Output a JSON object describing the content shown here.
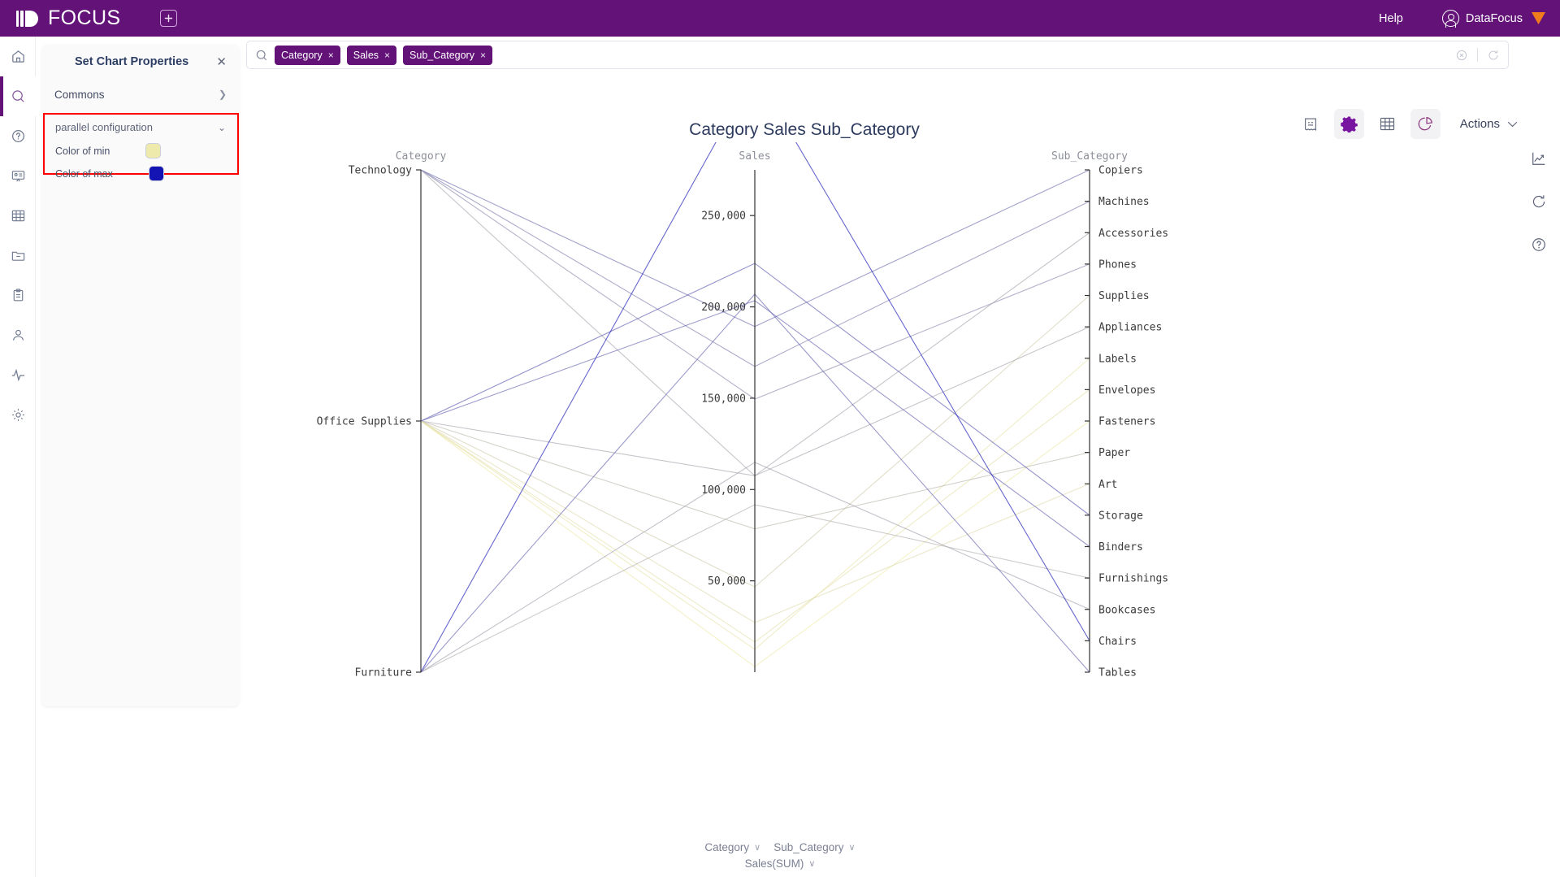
{
  "topbar": {
    "logo_text": "FOCUS",
    "add_tab_label": "+",
    "help_label": "Help",
    "user_name": "DataFocus"
  },
  "sidebar": {
    "items": [
      {
        "name": "home",
        "label": "Home",
        "active": false
      },
      {
        "name": "search",
        "label": "Search",
        "active": true
      },
      {
        "name": "help",
        "label": "Help",
        "active": false
      },
      {
        "name": "presentation",
        "label": "Presentation",
        "active": false
      },
      {
        "name": "table",
        "label": "Table",
        "active": false
      },
      {
        "name": "folder",
        "label": "Folder",
        "active": false
      },
      {
        "name": "clipboard",
        "label": "Clipboard",
        "active": false
      },
      {
        "name": "user",
        "label": "User",
        "active": false
      },
      {
        "name": "activity",
        "label": "Activity",
        "active": false
      },
      {
        "name": "settings",
        "label": "Settings",
        "active": false
      }
    ]
  },
  "panel": {
    "title": "Set Chart Properties",
    "commons_label": "Commons",
    "config_title": "parallel configuration",
    "color_min_label": "Color of min",
    "color_max_label": "Color of max",
    "color_min_value": "#eeeaab",
    "color_max_value": "#1414b4",
    "highlight_color": "#ff0000"
  },
  "search": {
    "chips": [
      "Category",
      "Sales",
      "Sub_Category"
    ],
    "chip_close_glyph": "×"
  },
  "chart_toolbar": {
    "buttons": [
      {
        "name": "receipt-icon",
        "selected": false
      },
      {
        "name": "gear-icon",
        "selected": true
      },
      {
        "name": "table-icon",
        "selected": false
      },
      {
        "name": "pie-chart-icon",
        "selected": true
      }
    ],
    "actions_label": "Actions"
  },
  "edge_icons": [
    "trend-chart-icon",
    "refresh-icon",
    "help-circle-icon"
  ],
  "footer_legend": {
    "row1": [
      "Category",
      "Sub_Category"
    ],
    "row2": [
      "Sales(SUM)"
    ],
    "chevron": "∨"
  },
  "chart_data": {
    "type": "parallel",
    "title": "Category Sales Sub_Category",
    "color_min": "#eeeaab",
    "color_max": "#1414b4",
    "axes": [
      {
        "name": "Category",
        "type": "category",
        "categories": [
          "Technology",
          "Office Supplies",
          "Furniture"
        ]
      },
      {
        "name": "Sales",
        "type": "value",
        "ticks": [
          "50,000",
          "100,000",
          "150,000",
          "200,000",
          "250,000"
        ],
        "tick_values": [
          50000,
          100000,
          150000,
          200000,
          250000
        ],
        "range": [
          0,
          275000
        ]
      },
      {
        "name": "Sub_Category",
        "type": "category",
        "categories": [
          "Copiers",
          "Machines",
          "Accessories",
          "Phones",
          "Supplies",
          "Appliances",
          "Labels",
          "Envelopes",
          "Fasteners",
          "Paper",
          "Art",
          "Storage",
          "Binders",
          "Furnishings",
          "Bookcases",
          "Chairs",
          "Tables"
        ]
      }
    ],
    "lines": [
      {
        "category": "Technology",
        "sales": 149528,
        "sub_category": "Phones"
      },
      {
        "category": "Technology",
        "sales": 189239,
        "sub_category": "Copiers"
      },
      {
        "category": "Technology",
        "sales": 167380,
        "sub_category": "Machines"
      },
      {
        "category": "Technology",
        "sales": 107532,
        "sub_category": "Accessories"
      },
      {
        "category": "Office Supplies",
        "sales": 46674,
        "sub_category": "Supplies"
      },
      {
        "category": "Office Supplies",
        "sales": 107532,
        "sub_category": "Appliances"
      },
      {
        "category": "Office Supplies",
        "sales": 12486,
        "sub_category": "Labels"
      },
      {
        "category": "Office Supplies",
        "sales": 16476,
        "sub_category": "Envelopes"
      },
      {
        "category": "Office Supplies",
        "sales": 3024,
        "sub_category": "Fasteners"
      },
      {
        "category": "Office Supplies",
        "sales": 78479,
        "sub_category": "Paper"
      },
      {
        "category": "Office Supplies",
        "sales": 27119,
        "sub_category": "Art"
      },
      {
        "category": "Office Supplies",
        "sales": 223844,
        "sub_category": "Storage"
      },
      {
        "category": "Office Supplies",
        "sales": 203413,
        "sub_category": "Binders"
      },
      {
        "category": "Furniture",
        "sales": 91705,
        "sub_category": "Furnishings"
      },
      {
        "category": "Furniture",
        "sales": 114880,
        "sub_category": "Bookcases"
      },
      {
        "category": "Furniture",
        "sales": 328449,
        "sub_category": "Chairs"
      },
      {
        "category": "Furniture",
        "sales": 206966,
        "sub_category": "Tables"
      }
    ]
  }
}
